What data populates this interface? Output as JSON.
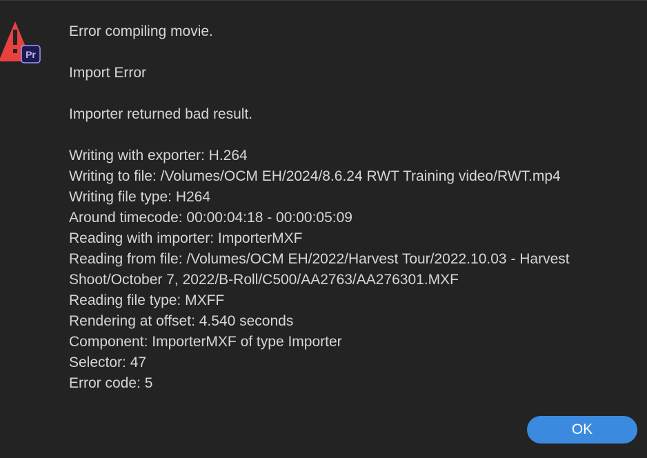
{
  "dialog": {
    "icons": {
      "warning": "warning-triangle-icon",
      "app_badge": "premiere-pro-icon",
      "app_badge_text": "Pr"
    },
    "paragraph1": "Error compiling movie.",
    "paragraph2": "Import Error",
    "paragraph3": "Importer returned bad result.",
    "details": [
      "Writing with exporter: H.264",
      "Writing to file: /Volumes/OCM EH/2024/8.6.24 RWT Training video/RWT.mp4",
      "Writing file type: H264",
      "Around timecode: 00:00:04:18 - 00:00:05:09",
      "Reading with importer: ImporterMXF",
      "Reading from file: /Volumes/OCM EH/2022/Harvest Tour/2022.10.03 - Harvest Shoot/October 7, 2022/B-Roll/C500/AA2763/AA276301.MXF",
      "Reading file type: MXFF",
      "Rendering at offset: 4.540 seconds",
      "Component: ImporterMXF of type Importer",
      "Selector: 47",
      "Error code: 5"
    ],
    "ok_label": "OK"
  },
  "colors": {
    "background": "#232323",
    "text": "#d6d6d6",
    "warning": "#e8423f",
    "badge_bg": "#1f1a4d",
    "badge_border": "#9b9bff",
    "badge_text": "#b9b6ff",
    "button": "#3b8ae0"
  }
}
